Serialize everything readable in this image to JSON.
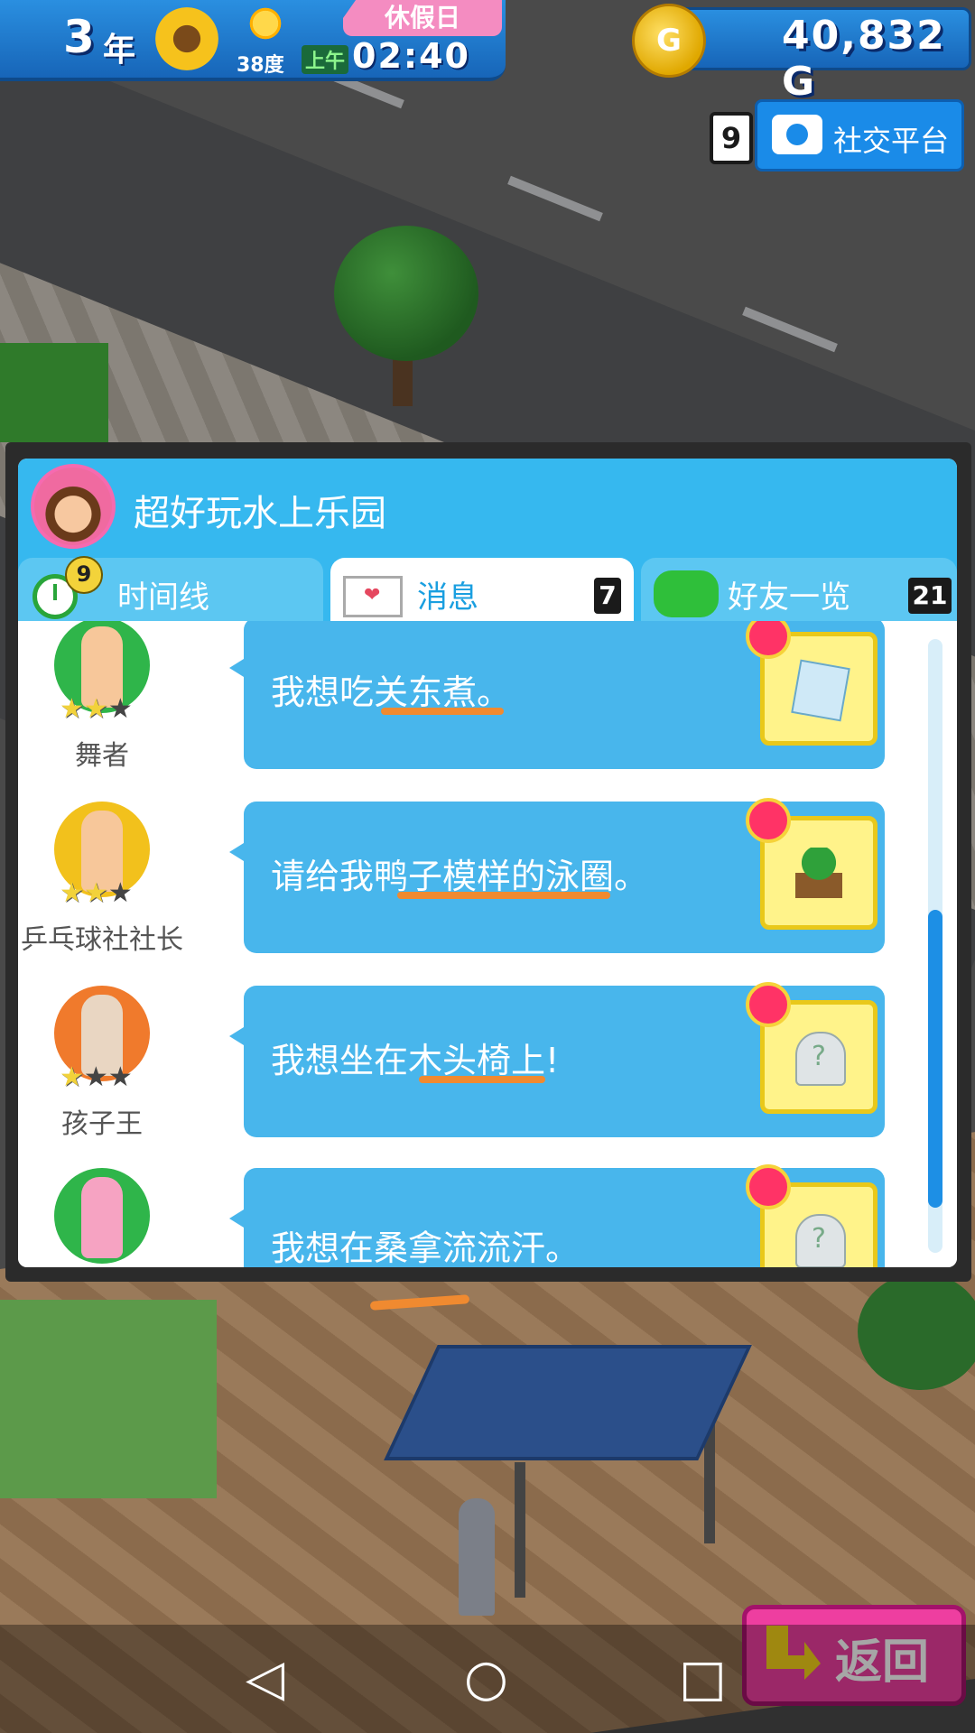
{
  "hud": {
    "year_number": "3",
    "year_unit": "年",
    "temperature": "38度",
    "holiday_label": "休假日",
    "ampm": "上午",
    "time": "02:40",
    "coin_symbol": "G",
    "money": "40,832 G"
  },
  "social": {
    "notification_count": "9",
    "label": "社交平台"
  },
  "panel": {
    "park_name": "超好玩水上乐园",
    "tabs": [
      {
        "label": "时间线",
        "badge": "9"
      },
      {
        "label": "消息",
        "count": "7"
      },
      {
        "label": "好友一览",
        "count": "21"
      }
    ],
    "messages": [
      {
        "role": "舞者",
        "stars": 2,
        "message": "我想吃关东煮。",
        "gift_icon": "ice-block-icon"
      },
      {
        "role": "乒乓球社社长",
        "stars": 2,
        "message": "请给我鸭子模样的泳圈。",
        "gift_icon": "palm-tree-icon"
      },
      {
        "role": "孩子王",
        "stars": 1,
        "message": "我想坐在木头椅上!",
        "gift_icon": "unknown-item-icon"
      },
      {
        "role": "",
        "stars": 0,
        "message": "我想在桑拿流流汗。",
        "gift_icon": "unknown-item-icon"
      }
    ]
  },
  "back_label": "返回",
  "colors": {
    "panel_header": "#36b8ef",
    "bubble": "#48b6ec",
    "back_button": "#ee3ea0",
    "annotation_underline": "#f08a30"
  },
  "nav": {
    "back": "◁",
    "home": "○",
    "recents": "□"
  }
}
